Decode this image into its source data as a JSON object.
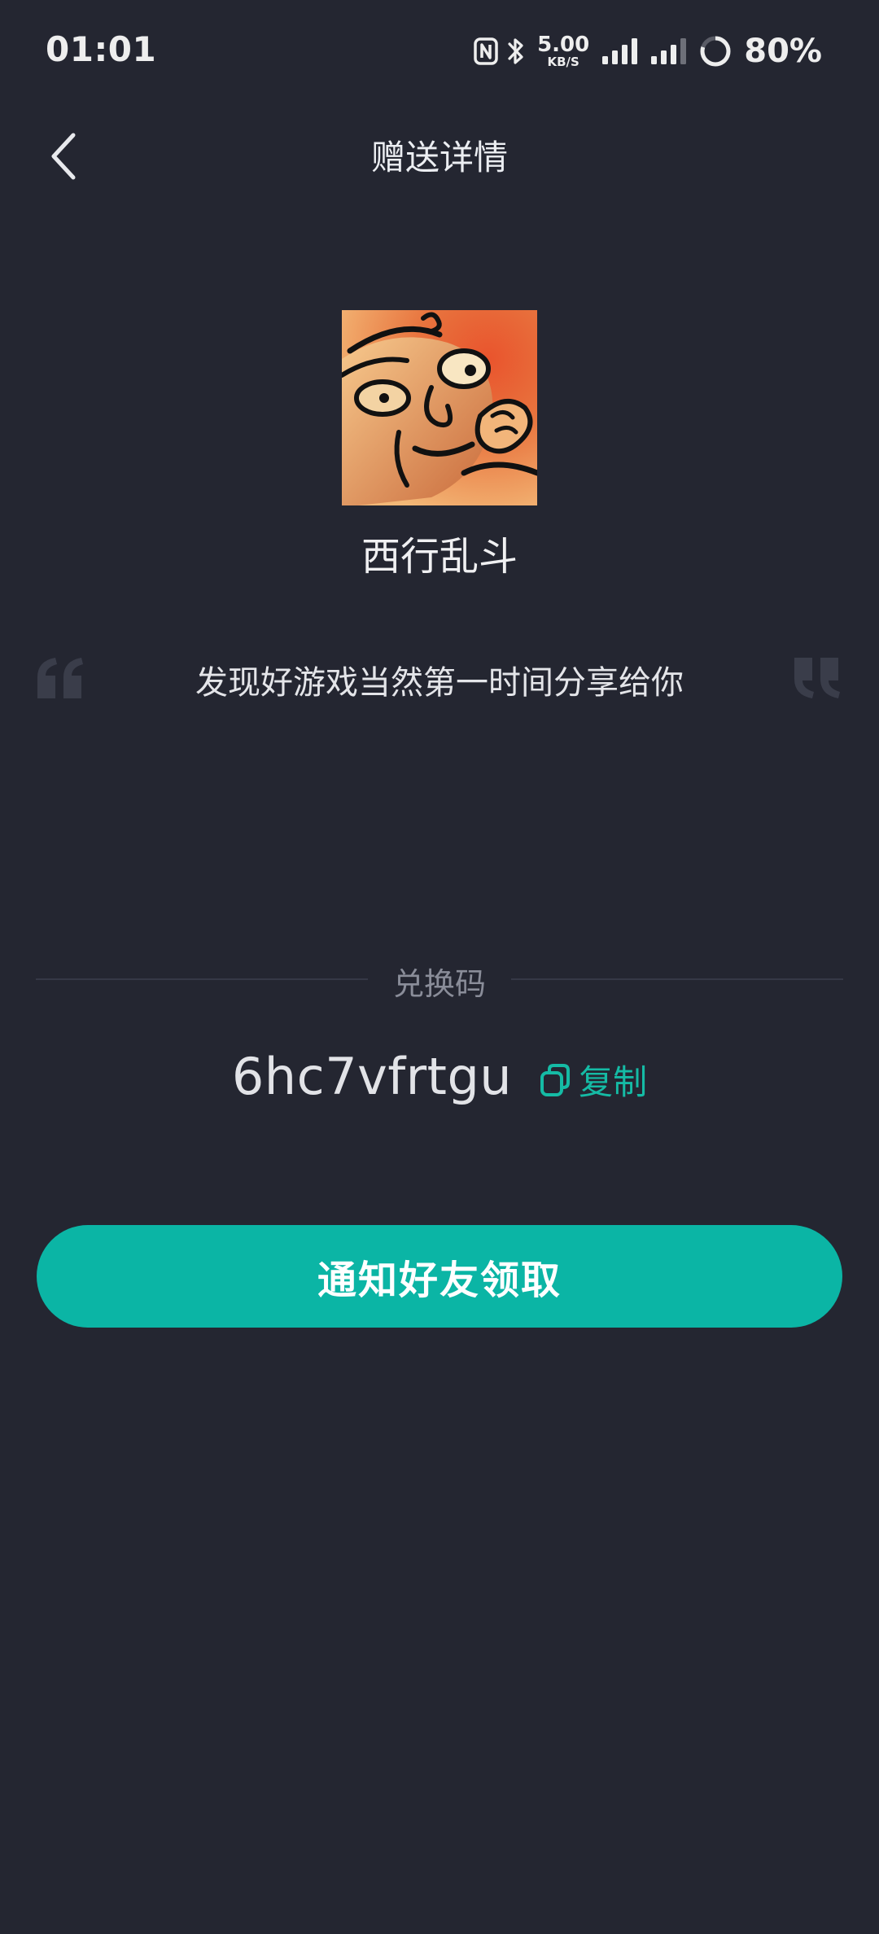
{
  "status_bar": {
    "time": "01:01",
    "net_speed_value": "5.00",
    "net_speed_unit": "KB/S",
    "battery": "80%",
    "icons": [
      "nfc-icon",
      "bluetooth-icon",
      "signal-icon",
      "signal-icon",
      "battery-ring-icon"
    ]
  },
  "header": {
    "title": "赠送详情",
    "back_icon": "chevron-left-icon"
  },
  "game": {
    "name": "西行乱斗",
    "icon": "game-cover-image"
  },
  "message": {
    "text": "发现好游戏当然第一时间分享给你",
    "open_quote_icon": "quote-open-icon",
    "close_quote_icon": "quote-close-icon"
  },
  "redeem": {
    "label": "兑换码",
    "code": "6hc7vfrtgu",
    "copy_label": "复制",
    "copy_icon": "copy-icon"
  },
  "actions": {
    "notify_label": "通知好友领取"
  },
  "colors": {
    "background": "#242631",
    "accent": "#0bb5a5",
    "copy_text": "#15bba5",
    "muted_text": "#8a8d99"
  }
}
